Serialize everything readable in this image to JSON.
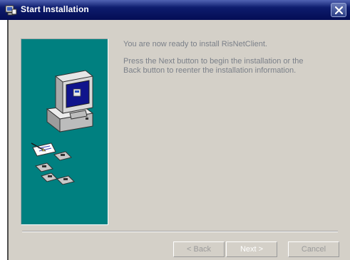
{
  "window": {
    "title": "Start Installation",
    "close_glyph": "✖"
  },
  "content": {
    "ready_message": "You are now ready to install RisNetClient.",
    "instructions": "Press the Next button to begin the installation or the Back button to reenter the installation information."
  },
  "buttons": {
    "back_label": "< Back",
    "next_label": "Next >",
    "cancel_label": "Cancel"
  },
  "colors": {
    "titlebar": "#0c1a6a",
    "panel_teal": "#008080",
    "dialog_bg": "#d4d0c8",
    "disabled_text": "#9a9a9a"
  },
  "icons": {
    "app": "installer-icon",
    "illustration": "computer-and-floppy-disks-illustration"
  },
  "state": {
    "back_enabled": false,
    "next_enabled": false,
    "cancel_enabled": false
  }
}
